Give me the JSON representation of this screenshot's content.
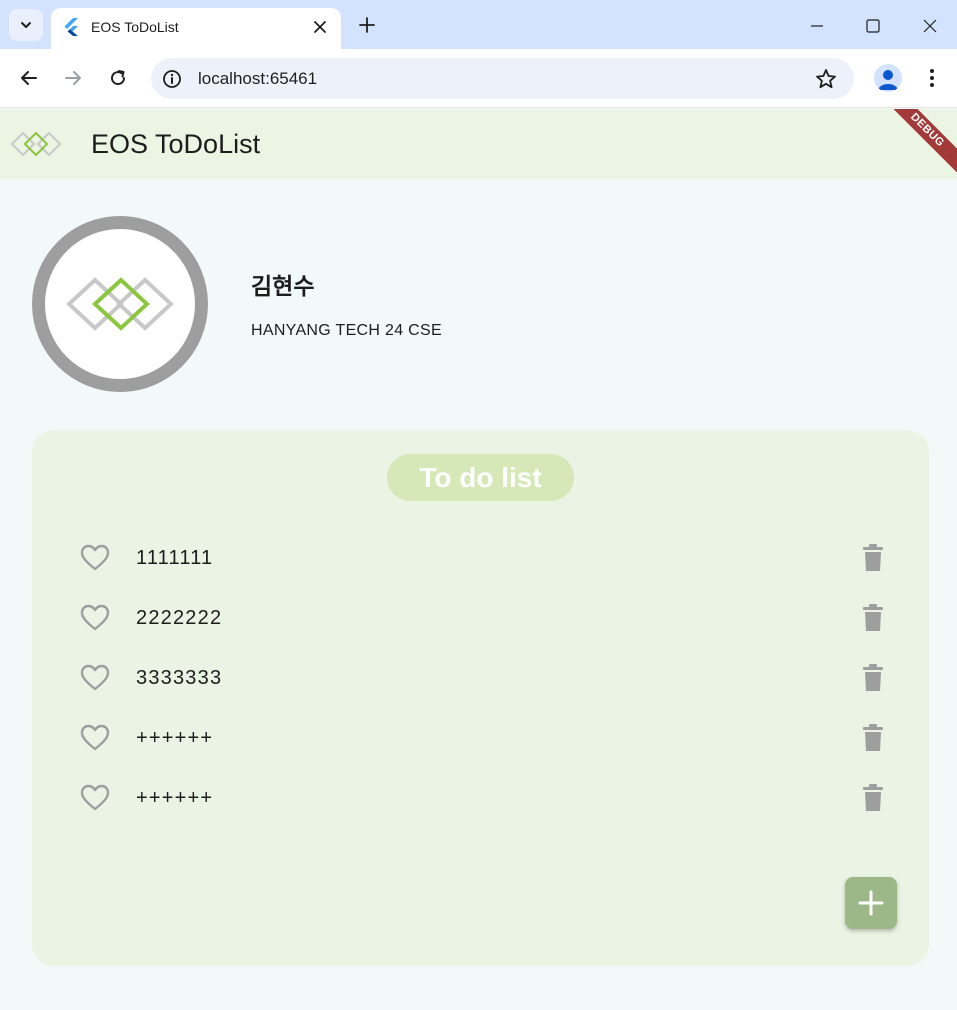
{
  "browser": {
    "tab_title": "EOS ToDoList",
    "url": "localhost:65461"
  },
  "app": {
    "title": "EOS ToDoList",
    "debug_banner": "DEBUG"
  },
  "profile": {
    "name": "김현수",
    "subtitle": "HANYANG TECH 24 CSE"
  },
  "todo": {
    "heading": "To do list",
    "items": [
      {
        "text": "1111111"
      },
      {
        "text": "2222222"
      },
      {
        "text": "3333333"
      },
      {
        "text": "++++++"
      },
      {
        "text": "++++++"
      }
    ]
  },
  "colors": {
    "appbar": "#ecf4e4",
    "card": "#ebf3e4",
    "pill": "#d7e8b8",
    "fab": "#9cb788",
    "accent_green": "#8cc63f",
    "icon_gray": "#9e9e9e"
  },
  "icons": [
    "chevron-down-icon",
    "flutter-icon",
    "close-icon",
    "plus-icon",
    "minimize-icon",
    "maximize-icon",
    "back-icon",
    "forward-icon",
    "reload-icon",
    "info-icon",
    "star-icon",
    "profile-icon",
    "kebab-icon",
    "eos-logo",
    "heart-icon",
    "trash-icon",
    "add-icon"
  ]
}
